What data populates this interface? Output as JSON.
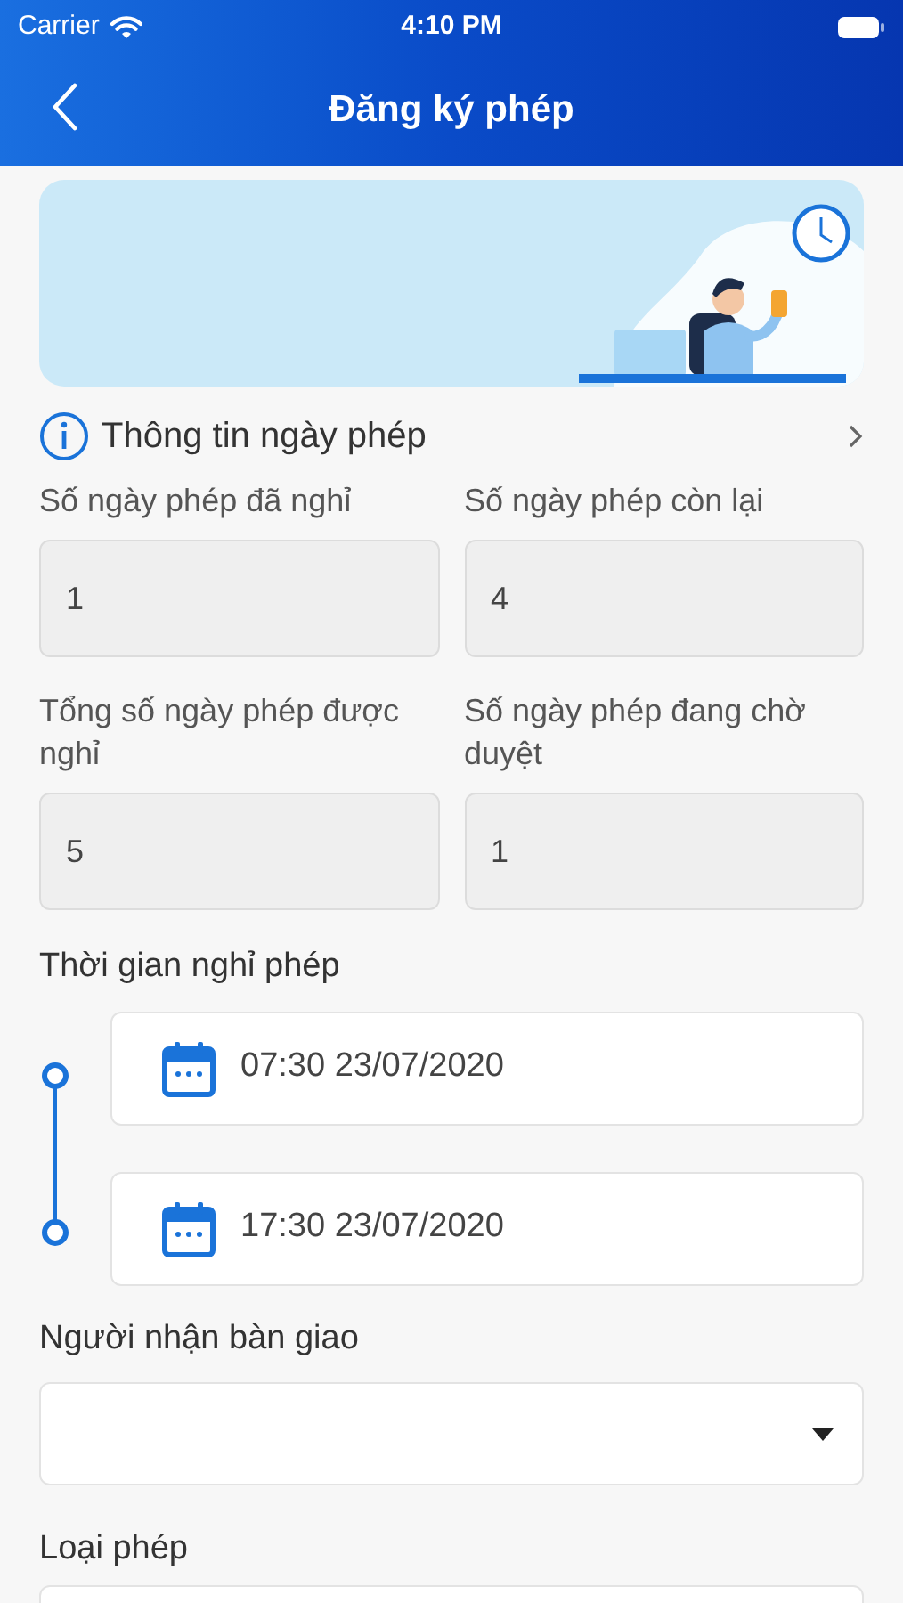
{
  "status_bar": {
    "carrier": "Carrier",
    "time": "4:10 PM"
  },
  "nav": {
    "title": "Đăng ký phép"
  },
  "info_section": {
    "title": "Thông tin ngày phép"
  },
  "stats": [
    {
      "label": "Số ngày phép đã nghỉ",
      "value": "1"
    },
    {
      "label": "Số ngày phép còn lại",
      "value": "4"
    },
    {
      "label": "Tổng số ngày phép được nghỉ",
      "value": "5"
    },
    {
      "label": "Số ngày phép đang chờ duyệt",
      "value": "1"
    }
  ],
  "time_section": {
    "label": "Thời gian nghỉ phép",
    "entries": [
      "07:30 23/07/2020",
      "17:30 23/07/2020"
    ]
  },
  "handover": {
    "label": "Người nhận bàn giao"
  },
  "leave_type": {
    "label": "Loại phép"
  }
}
